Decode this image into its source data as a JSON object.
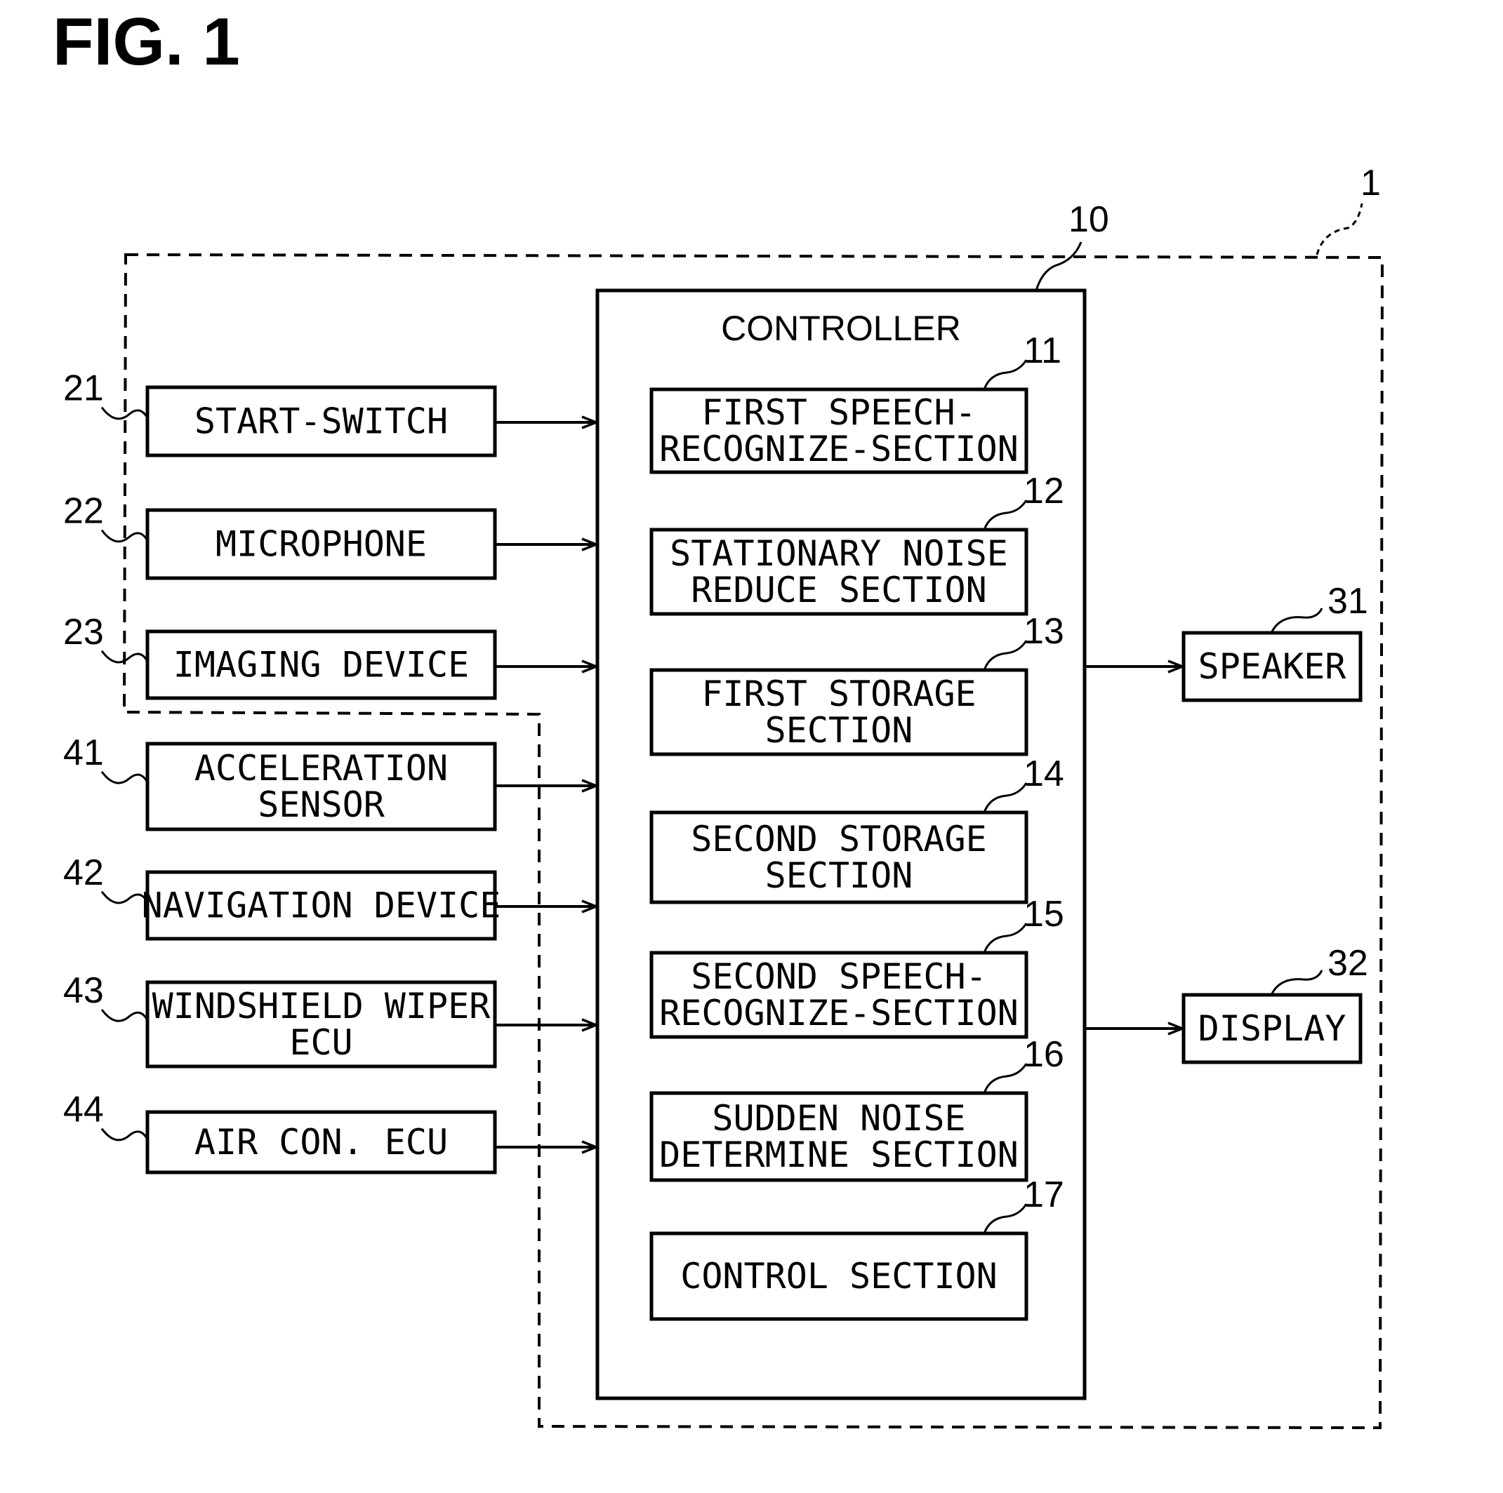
{
  "figure": {
    "title": "FIG. 1"
  },
  "system": {
    "ref": "1"
  },
  "controller": {
    "ref": "10",
    "title": "CONTROLLER",
    "sections": [
      {
        "ref": "11",
        "lines": [
          "FIRST SPEECH-",
          "RECOGNIZE-SECTION"
        ]
      },
      {
        "ref": "12",
        "lines": [
          "STATIONARY NOISE",
          "REDUCE SECTION"
        ]
      },
      {
        "ref": "13",
        "lines": [
          "FIRST STORAGE",
          "SECTION"
        ]
      },
      {
        "ref": "14",
        "lines": [
          "SECOND STORAGE",
          "SECTION"
        ]
      },
      {
        "ref": "15",
        "lines": [
          "SECOND SPEECH-",
          "RECOGNIZE-SECTION"
        ]
      },
      {
        "ref": "16",
        "lines": [
          "SUDDEN NOISE",
          "DETERMINE SECTION"
        ]
      },
      {
        "ref": "17",
        "lines": [
          "CONTROL SECTION"
        ]
      }
    ]
  },
  "inputs": [
    {
      "ref": "21",
      "lines": [
        "START-SWITCH"
      ]
    },
    {
      "ref": "22",
      "lines": [
        "MICROPHONE"
      ]
    },
    {
      "ref": "23",
      "lines": [
        "IMAGING DEVICE"
      ]
    },
    {
      "ref": "41",
      "lines": [
        "ACCELERATION",
        "SENSOR"
      ]
    },
    {
      "ref": "42",
      "lines": [
        "NAVIGATION DEVICE"
      ]
    },
    {
      "ref": "43",
      "lines": [
        "WINDSHIELD WIPER",
        "ECU"
      ]
    },
    {
      "ref": "44",
      "lines": [
        "AIR CON. ECU"
      ]
    }
  ],
  "outputs": [
    {
      "ref": "31",
      "lines": [
        "SPEAKER"
      ]
    },
    {
      "ref": "32",
      "lines": [
        "DISPLAY"
      ]
    }
  ]
}
